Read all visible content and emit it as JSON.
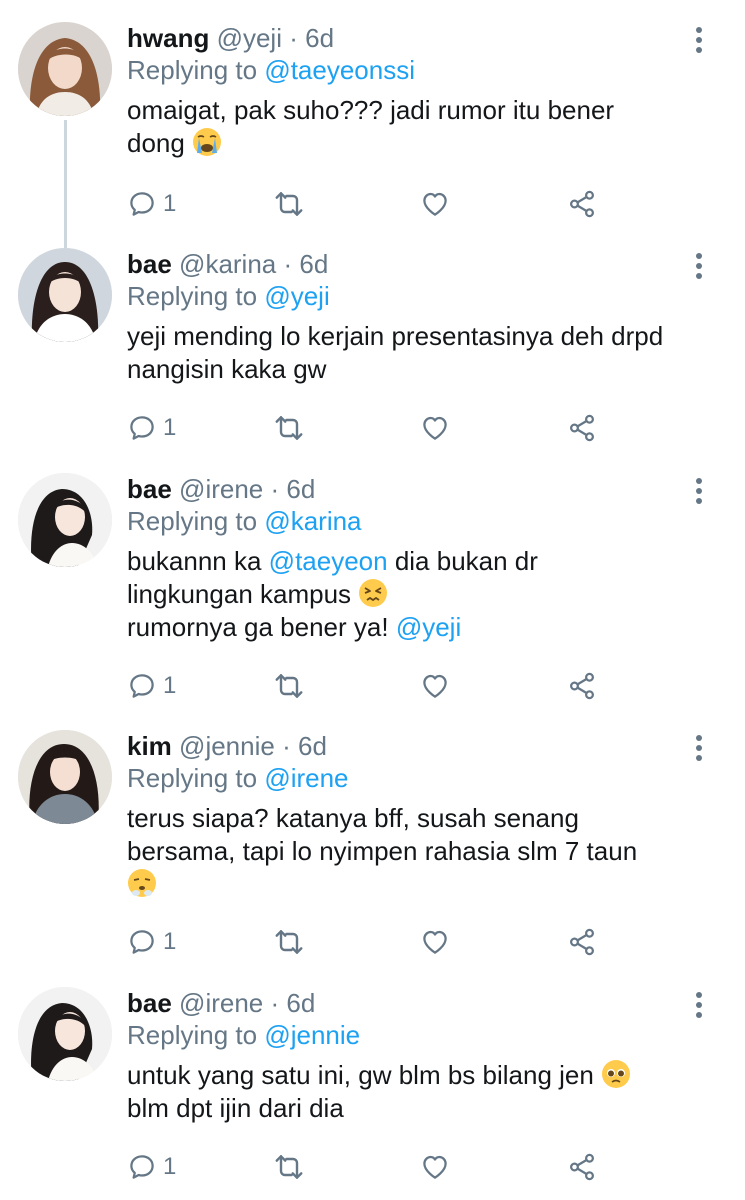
{
  "tweets": [
    {
      "name": "hwang",
      "handle": "@yeji",
      "dot": "·",
      "time": "6d",
      "replying_prefix": "Replying to ",
      "replying_to": "@taeyeonssi",
      "text_l1": "omaigat, pak suho??? jadi rumor itu bener",
      "text_l2": "dong",
      "emoji": "loudly-crying-face",
      "reply_count": "1"
    },
    {
      "name": "bae",
      "handle": "@karina",
      "dot": "·",
      "time": "6d",
      "replying_prefix": "Replying to ",
      "replying_to": "@yeji",
      "text_l1": "yeji mending lo kerjain presentasinya deh drpd",
      "text_l2": "nangisin kaka gw",
      "reply_count": "1"
    },
    {
      "name": "bae",
      "handle": "@irene",
      "dot": "·",
      "time": "6d",
      "replying_prefix": "Replying to ",
      "replying_to": "@karina",
      "text_l1a": "bukannn ka ",
      "text_l1_mention": "@taeyeon",
      "text_l1b": " dia bukan dr",
      "text_l2": "lingkungan kampus",
      "emoji": "persevering-face",
      "text_l3": "rumornya ga bener ya! ",
      "text_l3_mention": "@yeji",
      "reply_count": "1"
    },
    {
      "name": "kim",
      "handle": "@jennie",
      "dot": "·",
      "time": "6d",
      "replying_prefix": "Replying to ",
      "replying_to": "@irene",
      "text_l1": "terus siapa? katanya bff, susah senang",
      "text_l2": "bersama, tapi lo nyimpen rahasia slm 7 taun",
      "emoji": "face-with-steam-from-nose",
      "reply_count": "1"
    },
    {
      "name": "bae",
      "handle": "@irene",
      "dot": "·",
      "time": "6d",
      "replying_prefix": "Replying to ",
      "replying_to": "@jennie",
      "text_l1": "untuk yang satu ini, gw blm bs bilang jen",
      "emoji": "pleading-face",
      "text_l2": "blm dpt ijin dari dia",
      "reply_count": "1"
    }
  ],
  "icons": {
    "more": "more-vertical-icon",
    "reply": "reply-icon",
    "retweet": "retweet-icon",
    "like": "heart-icon",
    "share": "share-icon"
  },
  "colors": {
    "mention": "#1da1f2",
    "secondary_text": "#657786",
    "primary_text": "#14171a",
    "thread_line": "#ccd6dd"
  }
}
